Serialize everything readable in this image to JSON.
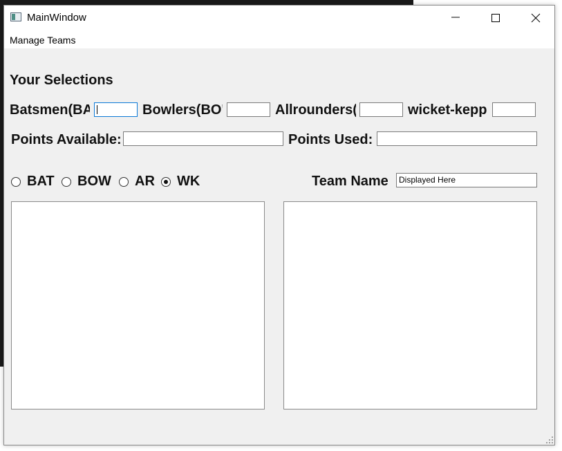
{
  "window": {
    "title": "MainWindow"
  },
  "title_bar_buttons": {
    "minimize_icon": "minimize-icon",
    "maximize_icon": "maximize-icon",
    "close_icon": "close-icon"
  },
  "menu": {
    "items": [
      "Manage Teams"
    ]
  },
  "selections": {
    "heading": "Your Selections",
    "batsmen_label": "Batsmen(BA",
    "bowlers_label": "Bowlers(BO'",
    "allrounders_label": "Allrounders(",
    "wicketkeepers_label": "wicket-kepp",
    "batsmen_value": "",
    "bowlers_value": "",
    "allrounders_value": "",
    "wicketkeepers_value": ""
  },
  "points": {
    "available_label": "Points Available:",
    "available_value": "",
    "used_label": "Points Used:",
    "used_value": ""
  },
  "roles": {
    "options": [
      "BAT",
      "BOW",
      "AR",
      "WK"
    ],
    "selected": "WK"
  },
  "team": {
    "label": "Team Name",
    "value": "Displayed Here"
  },
  "lists": {
    "available_players": [],
    "selected_players": []
  }
}
